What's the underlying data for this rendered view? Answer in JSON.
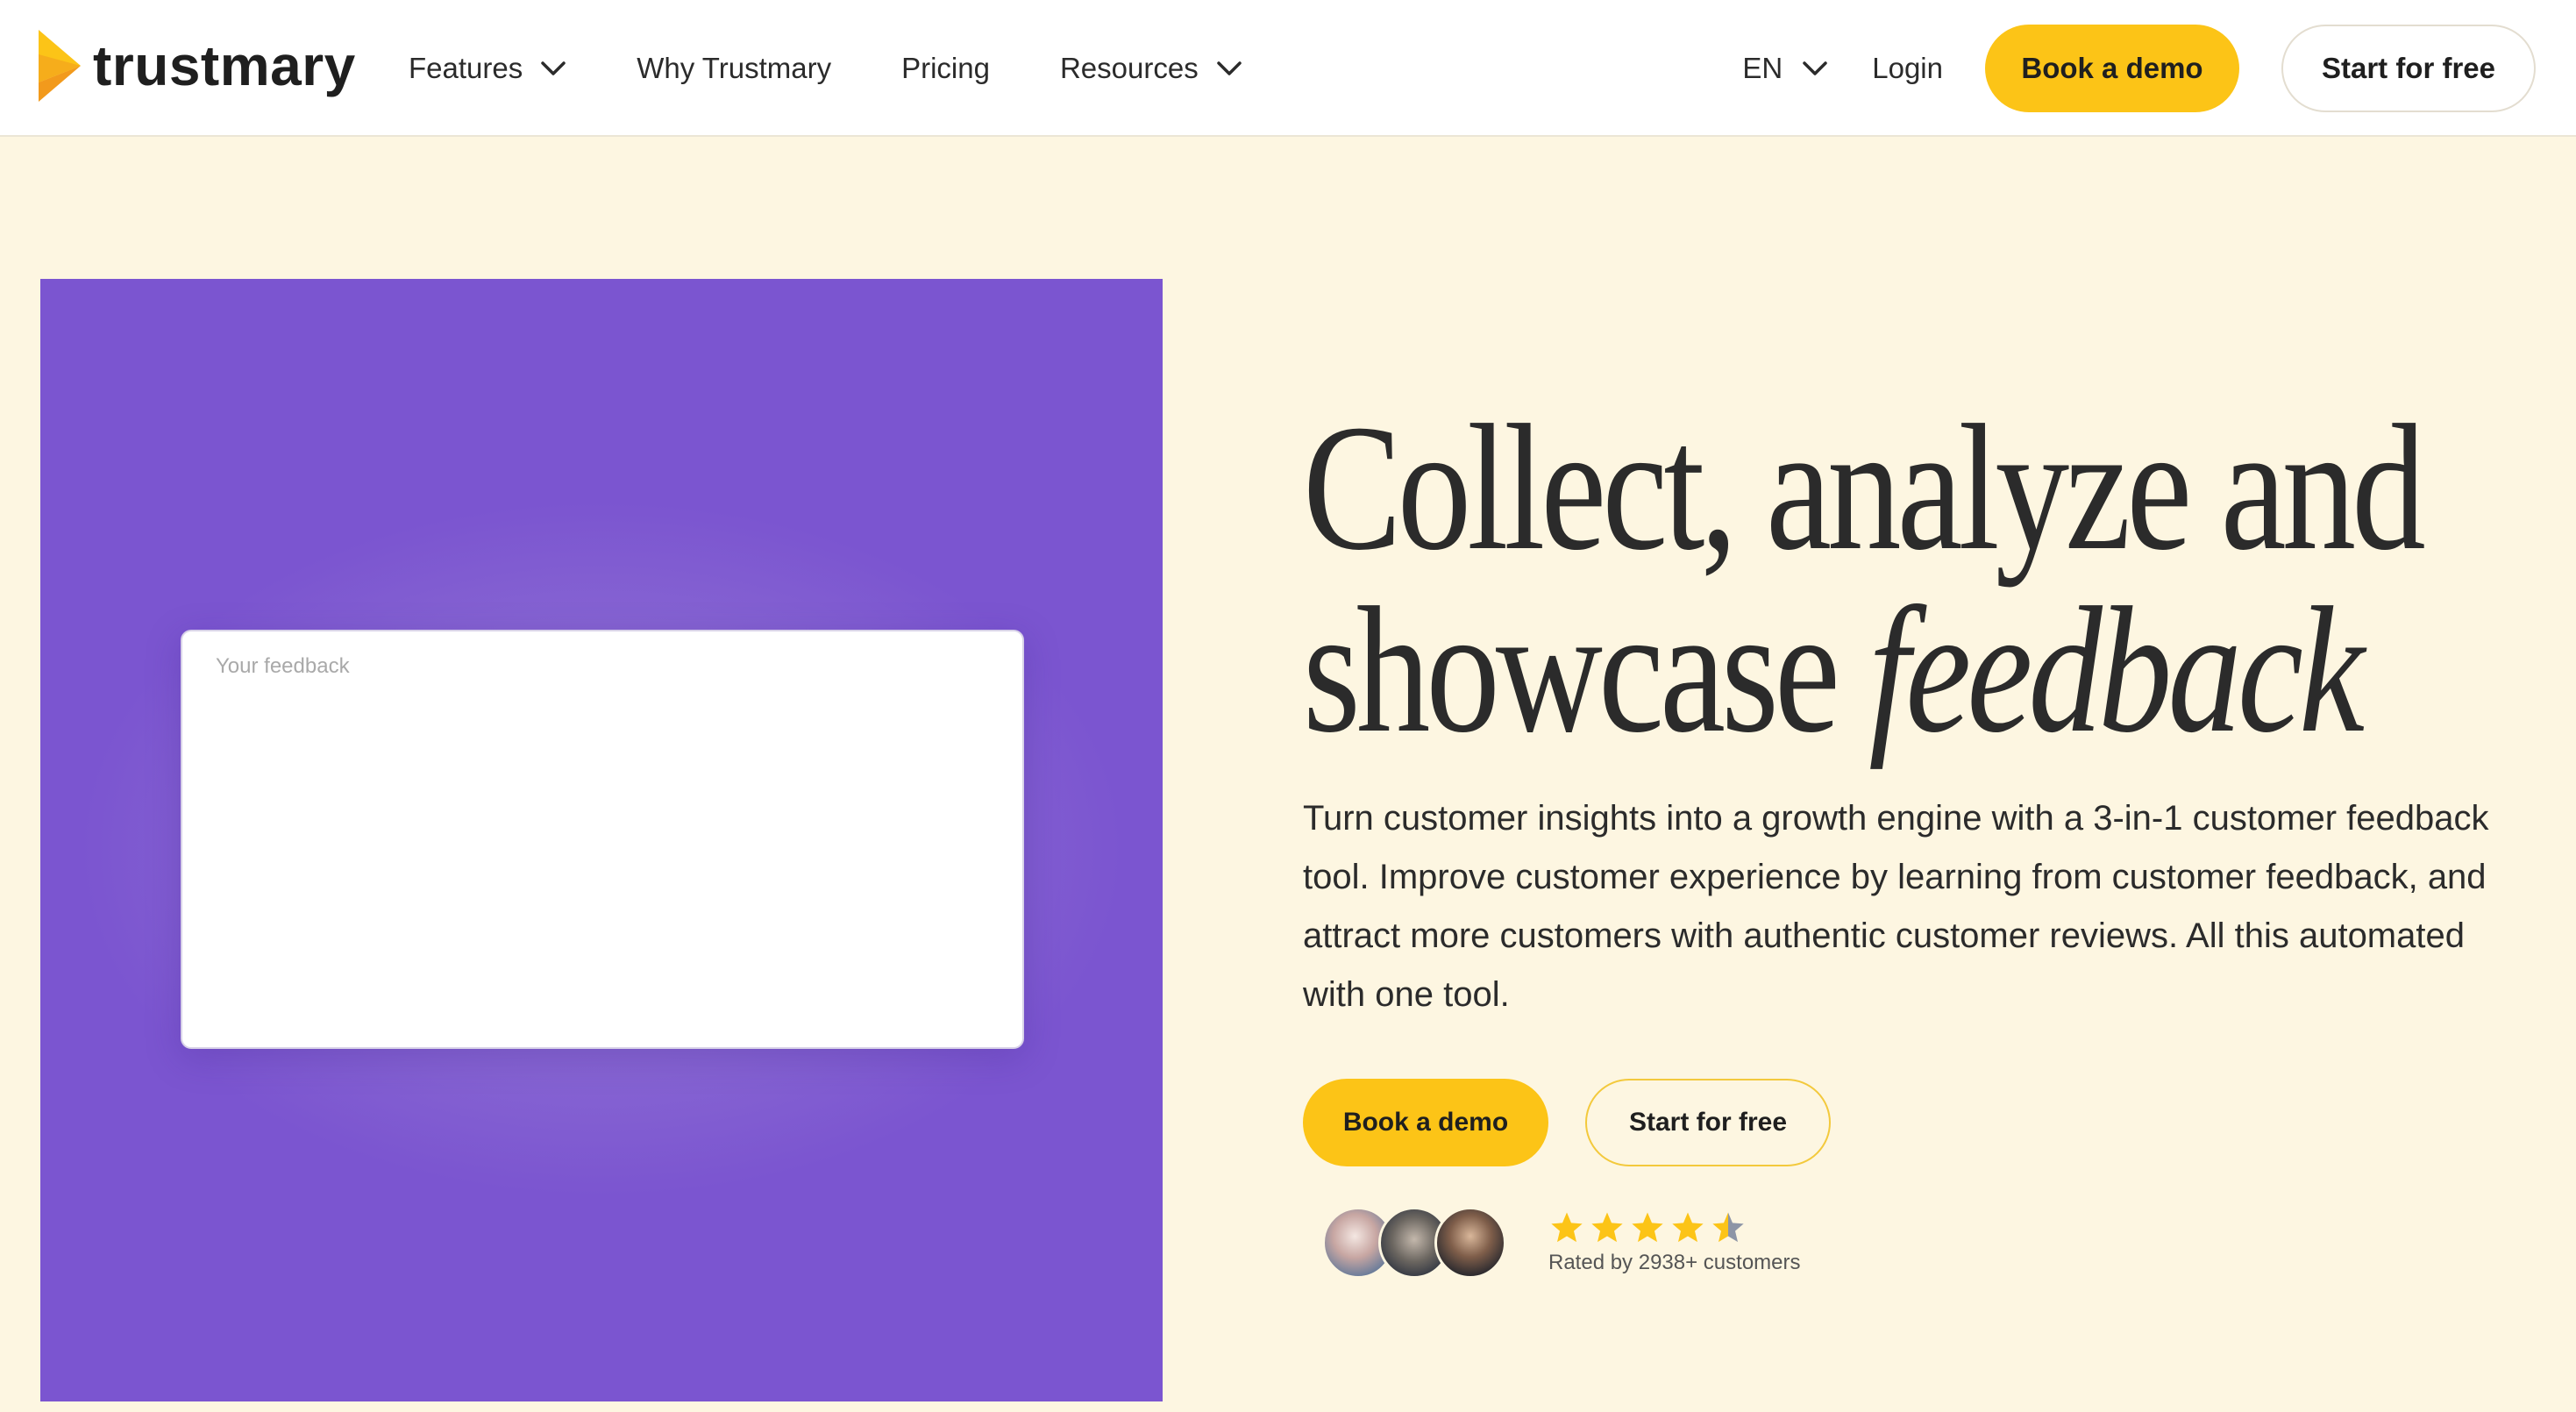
{
  "brand": {
    "name": "trustmary",
    "accent": "#fcc417",
    "panel_color": "#7b55d0",
    "background": "#fdf6e1"
  },
  "nav": {
    "items": [
      {
        "label": "Features",
        "has_dropdown": true
      },
      {
        "label": "Why Trustmary",
        "has_dropdown": false
      },
      {
        "label": "Pricing",
        "has_dropdown": false
      },
      {
        "label": "Resources",
        "has_dropdown": true
      }
    ],
    "language": "EN",
    "login": "Login",
    "book_demo": "Book a demo",
    "start_free": "Start for free"
  },
  "panel": {
    "feedback_placeholder": "Your feedback"
  },
  "hero": {
    "title_line1": "Collect, analyze and",
    "title_line2_plain": "showcase ",
    "title_line2_italic": "feedback",
    "description": "Turn customer insights into a growth engine with a 3-in-1 customer feedback tool. Improve customer experience by learning from customer feedback, and attract more customers with authentic customer reviews. All this automated with one tool.",
    "book_demo": "Book a demo",
    "start_free": "Start for free",
    "rating_stars": 4.5,
    "rated_text": "Rated by 2938+ customers"
  }
}
